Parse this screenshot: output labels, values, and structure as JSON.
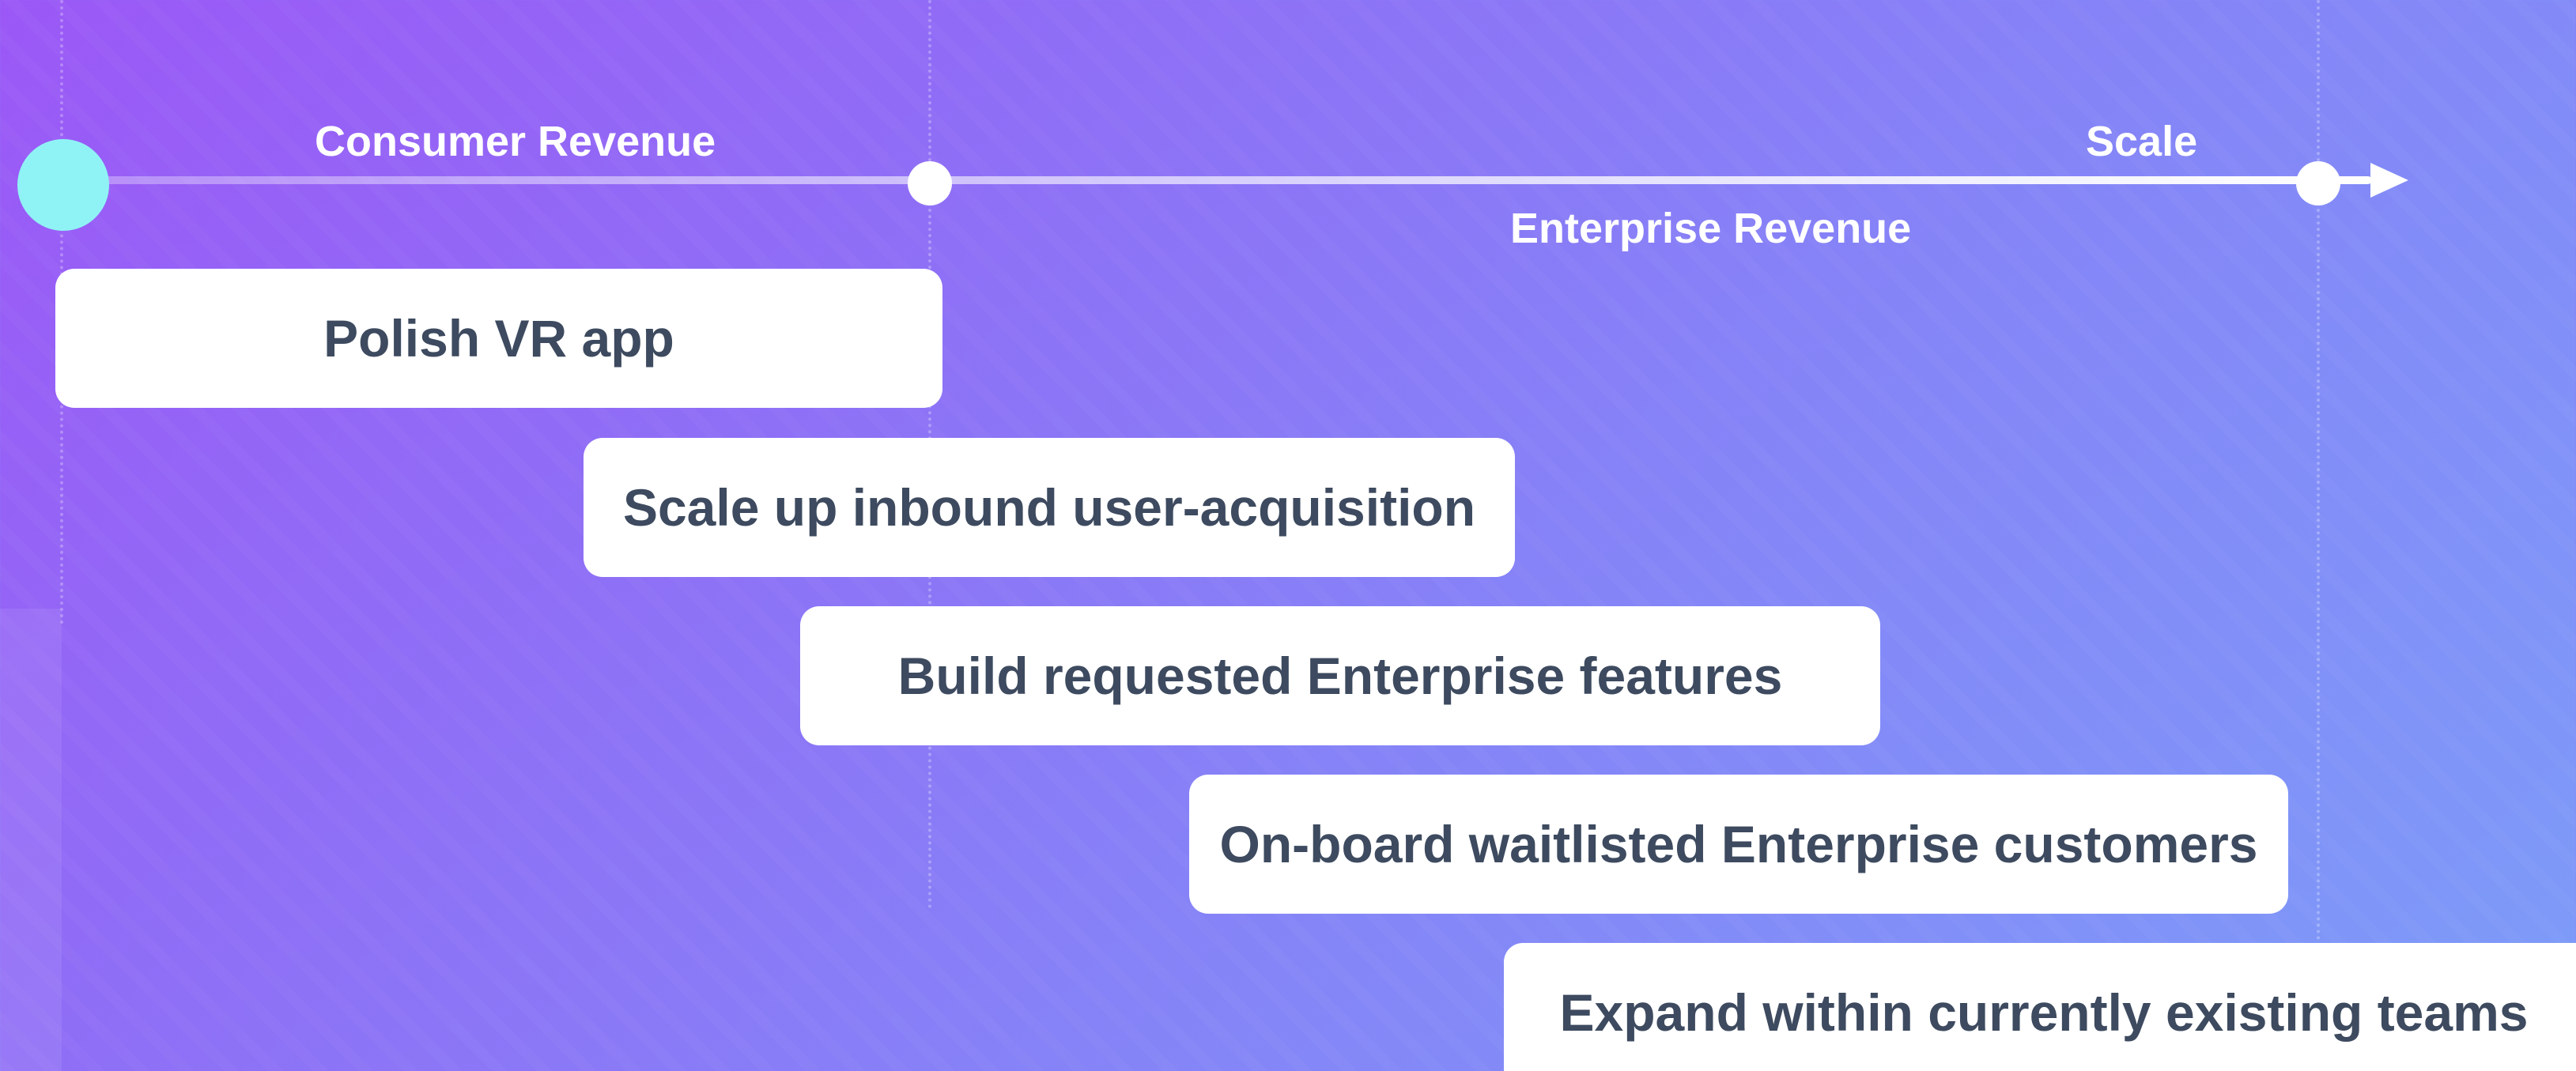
{
  "phases": {
    "consumer_revenue": "Consumer Revenue",
    "enterprise_revenue": "Enterprise Revenue",
    "scale": "Scale"
  },
  "tasks": [
    "Polish VR app",
    "Scale up inbound user-acquisition",
    "Build requested Enterprise features",
    "On-board waitlisted Enterprise customers",
    "Expand within currently existing teams"
  ],
  "colors": {
    "background_start": "#9b58f6",
    "background_end": "#7d9cf8",
    "start_node": "#8ff3f5",
    "task_text": "#3d4a5f",
    "task_box": "#ffffff"
  },
  "icons": {
    "start_node": "circle",
    "milestone": "circle",
    "arrow": "arrow-right"
  }
}
